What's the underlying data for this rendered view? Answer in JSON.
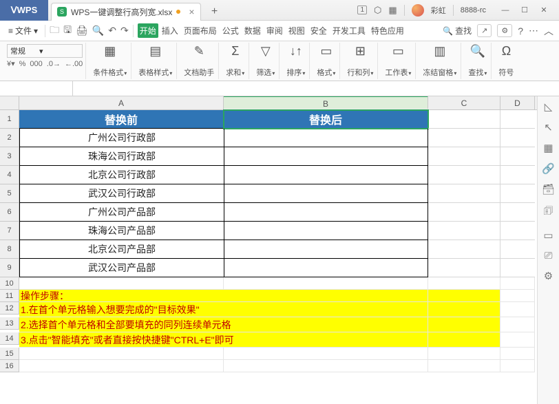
{
  "titlebar": {
    "logo": "WPS",
    "tab_name": "WPS一键调整行高列宽.xlsx",
    "badge": "1",
    "user": "彩虹",
    "user_id": "8888-rc"
  },
  "menu": {
    "file": "文件",
    "tabs": [
      "开始",
      "插入",
      "页面布局",
      "公式",
      "数据",
      "审阅",
      "视图",
      "安全",
      "开发工具",
      "特色应用"
    ],
    "search": "查找"
  },
  "ribbon": {
    "format_sel": "常规",
    "groups": [
      {
        "label": "条件格式",
        "icon": "▦"
      },
      {
        "label": "表格样式",
        "icon": "▤"
      },
      {
        "label": "文档助手",
        "icon": "✎"
      },
      {
        "label": "求和",
        "icon": "Σ"
      },
      {
        "label": "筛选",
        "icon": "▽"
      },
      {
        "label": "排序",
        "icon": "↓↑"
      },
      {
        "label": "格式",
        "icon": "▭"
      },
      {
        "label": "行和列",
        "icon": "⊞"
      },
      {
        "label": "工作表",
        "icon": "▭"
      },
      {
        "label": "冻结窗格",
        "icon": "▥"
      },
      {
        "label": "查找",
        "icon": "🔍"
      },
      {
        "label": "符号",
        "icon": "Ω"
      }
    ]
  },
  "columns": [
    "A",
    "B",
    "C",
    "D"
  ],
  "headers": {
    "A": "替换前",
    "B": "替换后"
  },
  "rows": [
    "广州公司行政部",
    "珠海公司行政部",
    "北京公司行政部",
    "武汉公司行政部",
    "广州公司产品部",
    "珠海公司产品部",
    "北京公司产品部",
    "武汉公司产品部"
  ],
  "steps": {
    "title": "操作步骤：",
    "s1": "1.在首个单元格输入想要完成的\"目标效果\"",
    "s2": "2.选择首个单元格和全部要填充的同列连续单元格",
    "s3": "3.点击\"智能填充\"或者直接按快捷键\"CTRL+E\"即可"
  }
}
